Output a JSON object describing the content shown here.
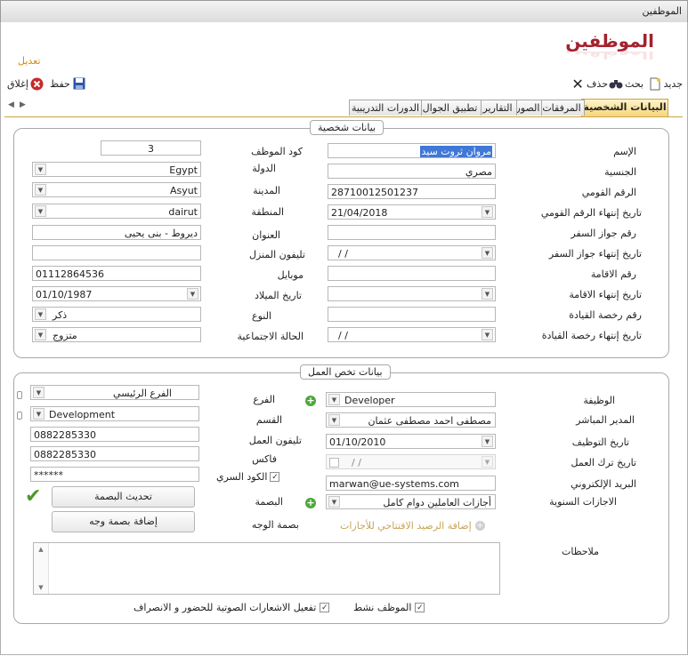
{
  "window": {
    "title": "الموظفين"
  },
  "header": {
    "logo": "الموظفين",
    "mode": "تعديل"
  },
  "toolbar": {
    "new": "جديد",
    "search": "بحث",
    "delete": "حذف",
    "save": "حفظ",
    "close": "إغلاق"
  },
  "tabs": [
    "البيانات الشخصية",
    "المرفقات",
    "الصور",
    "التقارير",
    "تطبيق الجوال",
    "الدورات التدريبية"
  ],
  "personal": {
    "legend": "بيانات شخصية",
    "name_label": "الإسم",
    "name_value": "مروان ثروت سيد",
    "nationality_label": "الجنسية",
    "nationality_value": "مصري",
    "national_id_label": "الرقم القومي",
    "national_id_value": "28710012501237",
    "national_id_expiry_label": "تاريخ إنتهاء الرقم القومي",
    "national_id_expiry_value": "21/04/2018",
    "passport_label": "رقم جواز السفر",
    "passport_value": "",
    "passport_expiry_label": "تاريخ إنتهاء جواز السفر",
    "passport_expiry_value": "/ /",
    "residence_label": "رقم الاقامة",
    "residence_value": "",
    "residence_expiry_label": "تاريخ إنتهاء الاقامة",
    "residence_expiry_value": "",
    "license_label": "رقم رخصة القيادة",
    "license_value": "",
    "license_expiry_label": "تاريخ إنتهاء رخصة القيادة",
    "license_expiry_value": "/ /",
    "code_label": "كود الموظف",
    "code_value": "3",
    "country_label": "الدولة",
    "country_value": "Egypt",
    "city_label": "المدينة",
    "city_value": "Asyut",
    "region_label": "المنطقة",
    "region_value": "dairut",
    "address_label": "العنوان",
    "address_value": "ديروط - بنى يحيى",
    "home_phone_label": "تليفون المنزل",
    "home_phone_value": "",
    "mobile_label": "موبايل",
    "mobile_value": "01112864536",
    "birth_label": "تاريخ الميلاد",
    "birth_value": "01/10/1987",
    "gender_label": "النوع",
    "gender_value": "ذكر",
    "marital_label": "الحالة الاجتماعية",
    "marital_value": "متزوج"
  },
  "work": {
    "legend": "بيانات تخص العمل",
    "job_label": "الوظيفة",
    "job_value": "Developer",
    "manager_label": "المدير المباشر",
    "manager_value": "مصطفى احمد مصطفى عثمان",
    "hire_label": "تاريخ التوظيف",
    "hire_value": "01/10/2010",
    "leave_label": "تاريخ ترك العمل",
    "leave_value": "/ /",
    "email_label": "البريد الإلكتروني",
    "email_value": "marwan@ue-systems.com",
    "vacation_label": "الاجازات السنوية",
    "vacation_value": "أجازات العاملين دوام كامل",
    "face_label": "بصمة الوجه",
    "opening_balance": "إضافة الرصيد الافتتاحي للأجازات",
    "branch_label": "الفرع",
    "branch_value": "الفرع الرئيسي",
    "dept_label": "القسم",
    "dept_value": "Development",
    "work_phone_label": "تليفون العمل",
    "work_phone_value": "0882285330",
    "fax_label": "فاكس",
    "fax_value": "0882285330",
    "secret_label": "الكود السري",
    "secret_value": "******",
    "finger_label": "البصمة",
    "update_finger": "تحديث البصمة",
    "add_face": "إضافة بصمة وجه",
    "notes_label": "ملاحظات",
    "active_label": "الموظف نشط",
    "voice_label": "تفعيل الاشعارات الصوتية للحضور و الانصراف"
  }
}
